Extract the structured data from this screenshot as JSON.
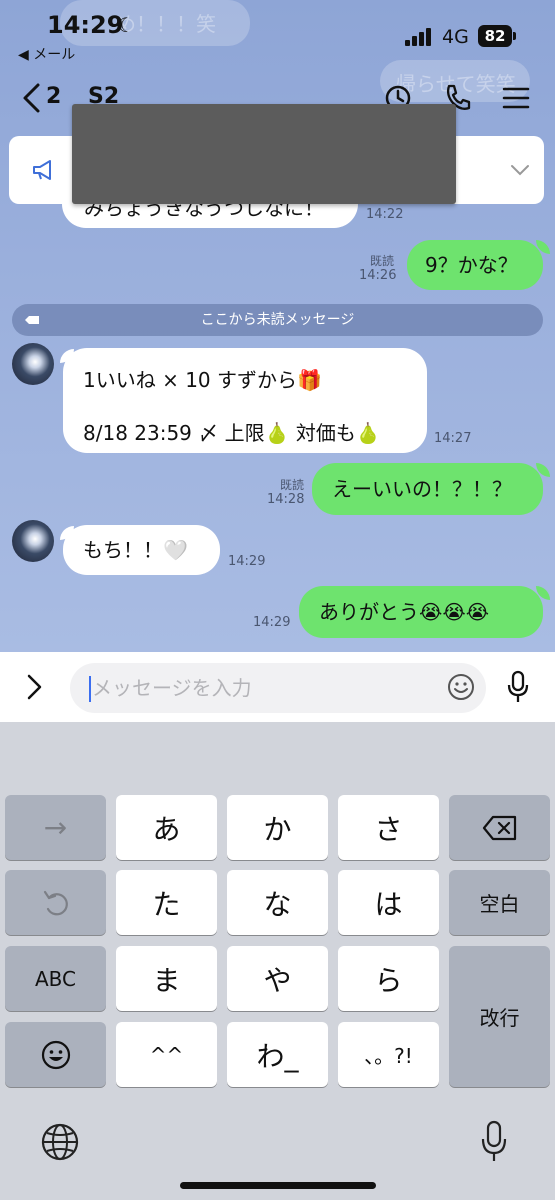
{
  "status_bar": {
    "time": "14:29",
    "back_app": "◀ メール",
    "network": "4G",
    "battery": "82"
  },
  "header": {
    "unread_count": "2",
    "room_name": "S2"
  },
  "background_text": {
    "top_left": "め！！！笑",
    "top_right": "帰らせて笑笑",
    "partial_message": "みちょうきなうつしなに！"
  },
  "messages": [
    {
      "side": "in",
      "text": "みちょうきなうつしなに！",
      "time": "14:22"
    },
    {
      "side": "out",
      "text": "9？かな？",
      "time": "14:26",
      "read": "既読"
    },
    {
      "side": "in",
      "line1": "1いいね × 10 すずから",
      "line1_emoji": "🎁",
      "line2_a": "8/18 23:59 〆 上限",
      "line2_emoji1": "🍐",
      "line2_b": "対価も",
      "line2_emoji2": "🍐",
      "time": "14:27"
    },
    {
      "side": "out",
      "text": "えーいいの！？！？",
      "time": "14:28",
      "read": "既読"
    },
    {
      "side": "in",
      "text": "もち！！",
      "emoji": "🤍",
      "time": "14:29"
    },
    {
      "side": "out",
      "text": "ありがとう",
      "emoji": "😭😭😭",
      "time": "14:29"
    }
  ],
  "unread_divider": "ここから未読メッセージ",
  "input": {
    "placeholder": "メッセージを入力"
  },
  "keyboard": {
    "row1": [
      "→",
      "あ",
      "か",
      "さ",
      "⌫"
    ],
    "row2": [
      "↺",
      "た",
      "な",
      "は",
      "空白"
    ],
    "row3": [
      "ABC",
      "ま",
      "や",
      "ら",
      "改行"
    ],
    "row4": [
      "☻",
      "^^",
      "わ_",
      "、。?!"
    ]
  },
  "colors": {
    "chat_background": "#9aafdc",
    "outgoing_bubble": "#6ee36e",
    "incoming_bubble": "#ffffff",
    "keyboard_background": "#d1d4db"
  }
}
